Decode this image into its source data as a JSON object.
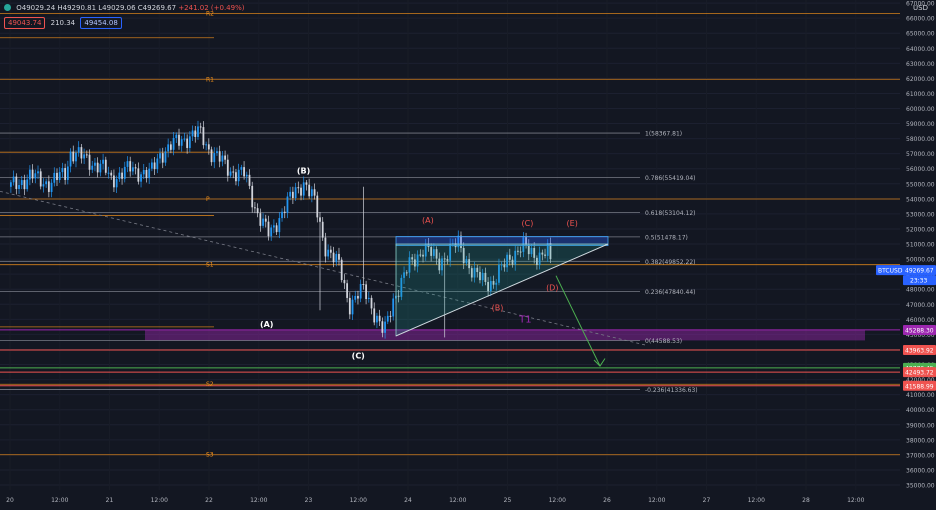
{
  "header": {
    "ohlc": "O49029.24 H49290.81 L49029.06 C49269.67",
    "change": "+241.02 (+0.49%)",
    "sell_price": "49043.74",
    "spread": "210.34",
    "buy_price": "49454.08",
    "currency": "USD"
  },
  "colors": {
    "background": "#131722",
    "up": "#2196f3",
    "down": "#d1d4dc",
    "pivot": "#f7931a",
    "fib": "#787b86",
    "wave_red": "#ef5350",
    "triangle": "#26a69a",
    "rectangle": "#2962ff",
    "zone": "#9c27b0",
    "arrow": "#4caf50"
  },
  "chart_data": {
    "type": "candlestick",
    "symbol": "BTCUSD",
    "price_axis": {
      "min": 35000,
      "max": 67000,
      "step": 1000,
      "labels": [
        "35000.00",
        "36000.00",
        "37000.00",
        "38000.00",
        "39000.00",
        "40000.00",
        "41000.00",
        "42000.00",
        "43000.00",
        "44000.00",
        "45000.00",
        "46000.00",
        "47000.00",
        "48000.00",
        "49000.00",
        "50000.00",
        "51000.00",
        "52000.00",
        "53000.00",
        "54000.00",
        "55000.00",
        "56000.00",
        "57000.00",
        "58000.00",
        "59000.00",
        "60000.00",
        "61000.00",
        "62000.00",
        "63000.00",
        "64000.00",
        "65000.00",
        "66000.00",
        "67000.00"
      ]
    },
    "time_axis": [
      "20",
      "12:00",
      "21",
      "12:00",
      "22",
      "12:00",
      "23",
      "12:00",
      "24",
      "12:00",
      "25",
      "12:00",
      "26",
      "12:00",
      "27",
      "12:00",
      "28",
      "12:00"
    ],
    "last_price": {
      "symbol": "BTCUSD",
      "value": "49269.67",
      "countdown": "23:33"
    },
    "price_tags": [
      {
        "value": "45288.30",
        "color": "#9c27b0"
      },
      {
        "value": "43963.92",
        "color": "#ef5350"
      },
      {
        "value": "42776.45",
        "color": "#4caf50"
      },
      {
        "value": "42493.72",
        "color": "#ef5350"
      },
      {
        "value": "41588.99",
        "color": "#ef5350"
      }
    ],
    "pivots": [
      {
        "label": "R2",
        "price": 66300
      },
      {
        "label": "R1",
        "price": 61940
      },
      {
        "label": "P",
        "price": 53990
      },
      {
        "label": "S1",
        "price": 49630
      },
      {
        "label": "S2",
        "price": 41690
      },
      {
        "label": "S3",
        "price": 37010
      }
    ],
    "fib_levels": [
      {
        "ratio": "1",
        "price": 58367.81,
        "label": "1(58367.81)"
      },
      {
        "ratio": "0.786",
        "price": 55419.04,
        "label": "0.786(55419.04)"
      },
      {
        "ratio": "0.618",
        "price": 53104.12,
        "label": "0.618(53104.12)"
      },
      {
        "ratio": "0.5",
        "price": 51478.17,
        "label": "0.5(51478.17)"
      },
      {
        "ratio": "0.382",
        "price": 49852.22,
        "label": "0.382(49852.22)"
      },
      {
        "ratio": "0.236",
        "price": 47840.44,
        "label": "0.236(47840.44)"
      },
      {
        "ratio": "0",
        "price": 44588.53,
        "label": "0(44588.53)"
      },
      {
        "ratio": "-0.236",
        "price": 41336.63,
        "label": "-0.236(41336.63)"
      }
    ],
    "wave_labels": [
      {
        "text": "(B)",
        "day": 22.95,
        "price": 55700,
        "color": "#ffffff"
      },
      {
        "text": "(A)",
        "day": 22.58,
        "price": 45500,
        "color": "#ffffff"
      },
      {
        "text": "(C)",
        "day": 23.5,
        "price": 43400,
        "color": "#ffffff"
      },
      {
        "text": "(A)",
        "day": 24.2,
        "price": 52400,
        "color": "#ef5350"
      },
      {
        "text": "(B)",
        "day": 24.9,
        "price": 46600,
        "color": "#ef5350"
      },
      {
        "text": "(C)",
        "day": 25.2,
        "price": 52200,
        "color": "#ef5350"
      },
      {
        "text": "(D)",
        "day": 25.45,
        "price": 47900,
        "color": "#ef5350"
      },
      {
        "text": "(E)",
        "day": 25.65,
        "price": 52200,
        "color": "#ef5350"
      },
      {
        "text": "T1",
        "day": 25.18,
        "price": 45800,
        "color": "#9c27b0"
      }
    ]
  }
}
